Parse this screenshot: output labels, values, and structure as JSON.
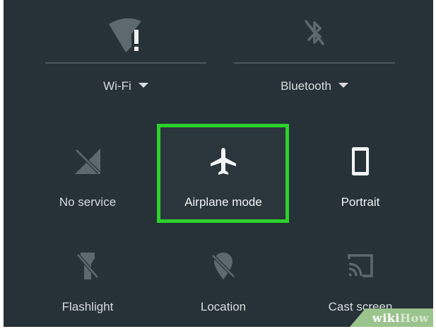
{
  "top_tiles": {
    "wifi": {
      "label": "Wi-Fi",
      "icon": "wifi-alert-icon"
    },
    "bluetooth": {
      "label": "Bluetooth",
      "icon": "bluetooth-disabled-icon"
    }
  },
  "tiles": [
    {
      "id": "no-service",
      "label": "No service",
      "icon": "no-signal-icon"
    },
    {
      "id": "airplane-mode",
      "label": "Airplane mode",
      "icon": "airplane-icon",
      "highlighted": true
    },
    {
      "id": "portrait",
      "label": "Portrait",
      "icon": "phone-portrait-icon"
    },
    {
      "id": "flashlight",
      "label": "Flashlight",
      "icon": "flashlight-off-icon"
    },
    {
      "id": "location",
      "label": "Location",
      "icon": "location-off-icon"
    },
    {
      "id": "cast-screen",
      "label": "Cast screen",
      "icon": "cast-icon"
    }
  ],
  "colors": {
    "panel_background": "#263238",
    "highlight_border": "#2cd12c",
    "dim_icon": "#5e696f",
    "bright_icon": "#f2f4f5",
    "text": "#d8dcde"
  },
  "watermark": {
    "part1": "wiki",
    "part2": "How"
  }
}
